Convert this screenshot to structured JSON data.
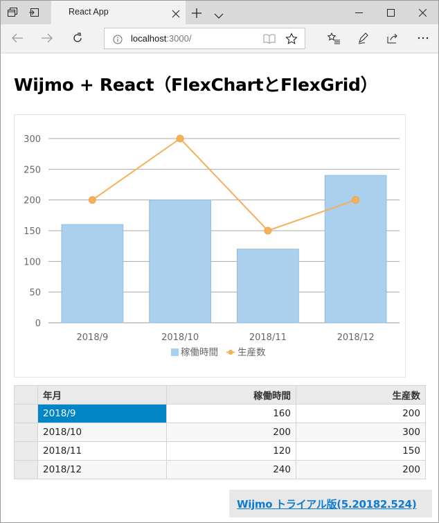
{
  "browser": {
    "tab_title": "React App",
    "url_host": "localhost",
    "url_path": ":3000/"
  },
  "page": {
    "heading": "Wijmo + React（FlexChartとFlexGrid）",
    "trial_link": "Wijmo トライアル版(5.20182.524)"
  },
  "colors": {
    "bar": "#aad0ee",
    "line": "#f5b05b",
    "selection": "#0085c7",
    "link": "#0b7bd5"
  },
  "chart_data": {
    "type": "bar",
    "categories": [
      "2018/9",
      "2018/10",
      "2018/11",
      "2018/12"
    ],
    "series": [
      {
        "name": "稼働時間",
        "type": "bar",
        "values": [
          160,
          200,
          120,
          240
        ]
      },
      {
        "name": "生産数",
        "type": "line",
        "values": [
          200,
          300,
          150,
          200
        ]
      }
    ],
    "yticks": [
      "0",
      "50",
      "100",
      "150",
      "200",
      "250",
      "300"
    ],
    "ylim": [
      0,
      300
    ],
    "grid": true,
    "legend_position": "bottom"
  },
  "grid": {
    "columns": [
      "年月",
      "稼働時間",
      "生産数"
    ],
    "rows": [
      {
        "ym": "2018/9",
        "hours": "160",
        "count": "200"
      },
      {
        "ym": "2018/10",
        "hours": "200",
        "count": "300"
      },
      {
        "ym": "2018/11",
        "hours": "120",
        "count": "150"
      },
      {
        "ym": "2018/12",
        "hours": "240",
        "count": "200"
      }
    ]
  }
}
